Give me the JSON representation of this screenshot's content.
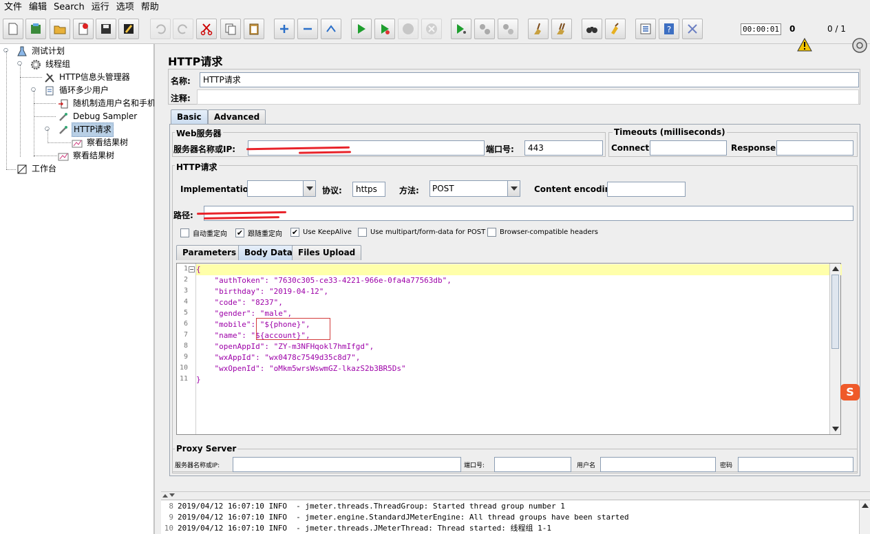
{
  "menu": [
    "文件",
    "编辑",
    "Search",
    "运行",
    "选项",
    "帮助"
  ],
  "toolbar": {
    "timer": "00:00:01",
    "errors": "0",
    "threads": "0 / 1"
  },
  "tree": {
    "items": [
      {
        "label": "测试计划"
      },
      {
        "label": "线程组"
      },
      {
        "label": "HTTP信息头管理器"
      },
      {
        "label": "循环多少用户"
      },
      {
        "label": "随机制造用户名和手机"
      },
      {
        "label": "Debug Sampler"
      },
      {
        "label": "HTTP请求"
      },
      {
        "label": "察看结果树"
      },
      {
        "label": "察看结果树"
      },
      {
        "label": "工作台"
      }
    ]
  },
  "panel": {
    "title": "HTTP请求",
    "name_label": "名称:",
    "name_value": "HTTP请求",
    "comment_label": "注释:",
    "tabs": [
      "Basic",
      "Advanced"
    ],
    "web_server": {
      "title": "Web服务器",
      "server_label": "服务器名称或IP:",
      "port_label": "端口号:",
      "port_value": "443"
    },
    "timeouts": {
      "title": "Timeouts (milliseconds)",
      "connect_label": "Connect:",
      "response_label": "Response:"
    },
    "http_request": {
      "title": "HTTP请求",
      "impl_label": "Implementation:",
      "protocol_label": "协议:",
      "protocol_value": "https",
      "method_label": "方法:",
      "method_value": "POST",
      "encoding_label": "Content encoding:",
      "path_label": "路径:"
    },
    "checkboxes": [
      {
        "label": "自动重定向",
        "checked": false
      },
      {
        "label": "跟随重定向",
        "checked": true
      },
      {
        "label": "Use KeepAlive",
        "checked": true
      },
      {
        "label": "Use multipart/form-data for POST",
        "checked": false
      },
      {
        "label": "Browser-compatible headers",
        "checked": false
      }
    ],
    "sub_tabs": [
      "Parameters",
      "Body Data",
      "Files Upload"
    ],
    "body_lines": [
      "{",
      "    \"authToken\": \"7630c305-ce33-4221-966e-0fa4a77563db\",",
      "    \"birthday\": \"2019-04-12\",",
      "    \"code\": \"8237\",",
      "    \"gender\": \"male\",",
      "    \"mobile\": \"${phone}\",",
      "    \"name\": \"${account}\",",
      "    \"openAppId\": \"ZY-m3NFHqokl7hmIfgd\",",
      "    \"wxAppId\": \"wx0478c7549d35c8d7\",",
      "    \"wxOpenId\": \"oMkm5wrsWswmGZ-lkazS2b3BR5Ds\"",
      "}"
    ],
    "proxy": {
      "title": "Proxy Server",
      "server_label": "服务器名称或IP:",
      "port_label": "端口号:",
      "user_label": "用户名",
      "password_label": "密码"
    }
  },
  "log": [
    {
      "n": "8",
      "text": "2019/04/12 16:07:10 INFO  - jmeter.threads.ThreadGroup: Started thread group number 1"
    },
    {
      "n": "9",
      "text": "2019/04/12 16:07:10 INFO  - jmeter.engine.StandardJMeterEngine: All thread groups have been started"
    },
    {
      "n": "10",
      "text": "2019/04/12 16:07:10 INFO  - jmeter.threads.JMeterThread: Thread started: 线程组 1-1"
    }
  ],
  "colors": {
    "accent": "#b8cfe5",
    "code": "#9d00a8",
    "highlight": "#ffffaa",
    "redact": "#e8232a"
  }
}
